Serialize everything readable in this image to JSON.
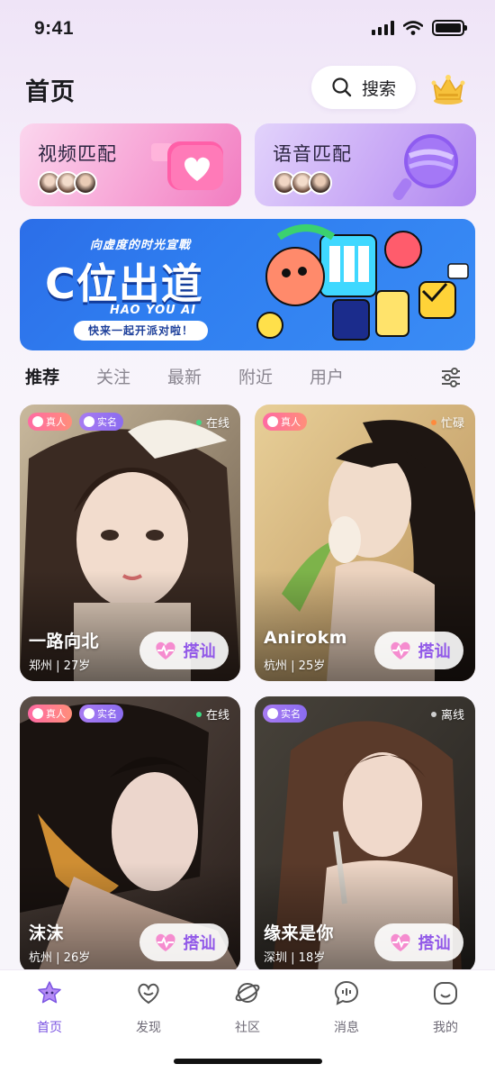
{
  "status_bar": {
    "time": "9:41"
  },
  "header": {
    "title": "首页",
    "search_label": "搜索"
  },
  "match_cards": {
    "video": {
      "title": "视频匹配"
    },
    "voice": {
      "title": "语音匹配"
    }
  },
  "banner": {
    "subtitle": "向虚度的时光宣戰",
    "main_text": "C位出道",
    "english": "HAO YOU AI",
    "pill": "快来一起开派对啦！"
  },
  "tabs": [
    {
      "label": "推荐",
      "active": true
    },
    {
      "label": "关注",
      "active": false
    },
    {
      "label": "最新",
      "active": false
    },
    {
      "label": "附近",
      "active": false
    },
    {
      "label": "用户",
      "active": false
    }
  ],
  "badge_labels": {
    "real": "真人",
    "verified": "实名"
  },
  "greet_label": "搭讪",
  "users": [
    {
      "name": "一路向北",
      "city": "郑州",
      "age": "27岁",
      "status": "在线",
      "status_color": "#3ddc84",
      "real": true,
      "verified": true
    },
    {
      "name": "Anirokm",
      "city": "杭州",
      "age": "25岁",
      "status": "忙碌",
      "status_color": "#ff8a3d",
      "real": true,
      "verified": false
    },
    {
      "name": "沫沫",
      "city": "杭州",
      "age": "26岁",
      "status": "在线",
      "status_color": "#3ddc84",
      "real": true,
      "verified": true
    },
    {
      "name": "缘来是你",
      "city": "深圳",
      "age": "18岁",
      "status": "离线",
      "status_color": "#cfcfcf",
      "real": false,
      "verified": true
    }
  ],
  "bottom_nav": [
    {
      "label": "首页",
      "icon": "star-home-icon",
      "active": true
    },
    {
      "label": "发现",
      "icon": "heart-discover-icon",
      "active": false
    },
    {
      "label": "社区",
      "icon": "planet-community-icon",
      "active": false
    },
    {
      "label": "消息",
      "icon": "chat-message-icon",
      "active": false
    },
    {
      "label": "我的",
      "icon": "smile-profile-icon",
      "active": false
    }
  ],
  "colors": {
    "accent": "#7b54e2",
    "greet_text": "#9158e8",
    "banner_bg": "#2f7ef0"
  }
}
